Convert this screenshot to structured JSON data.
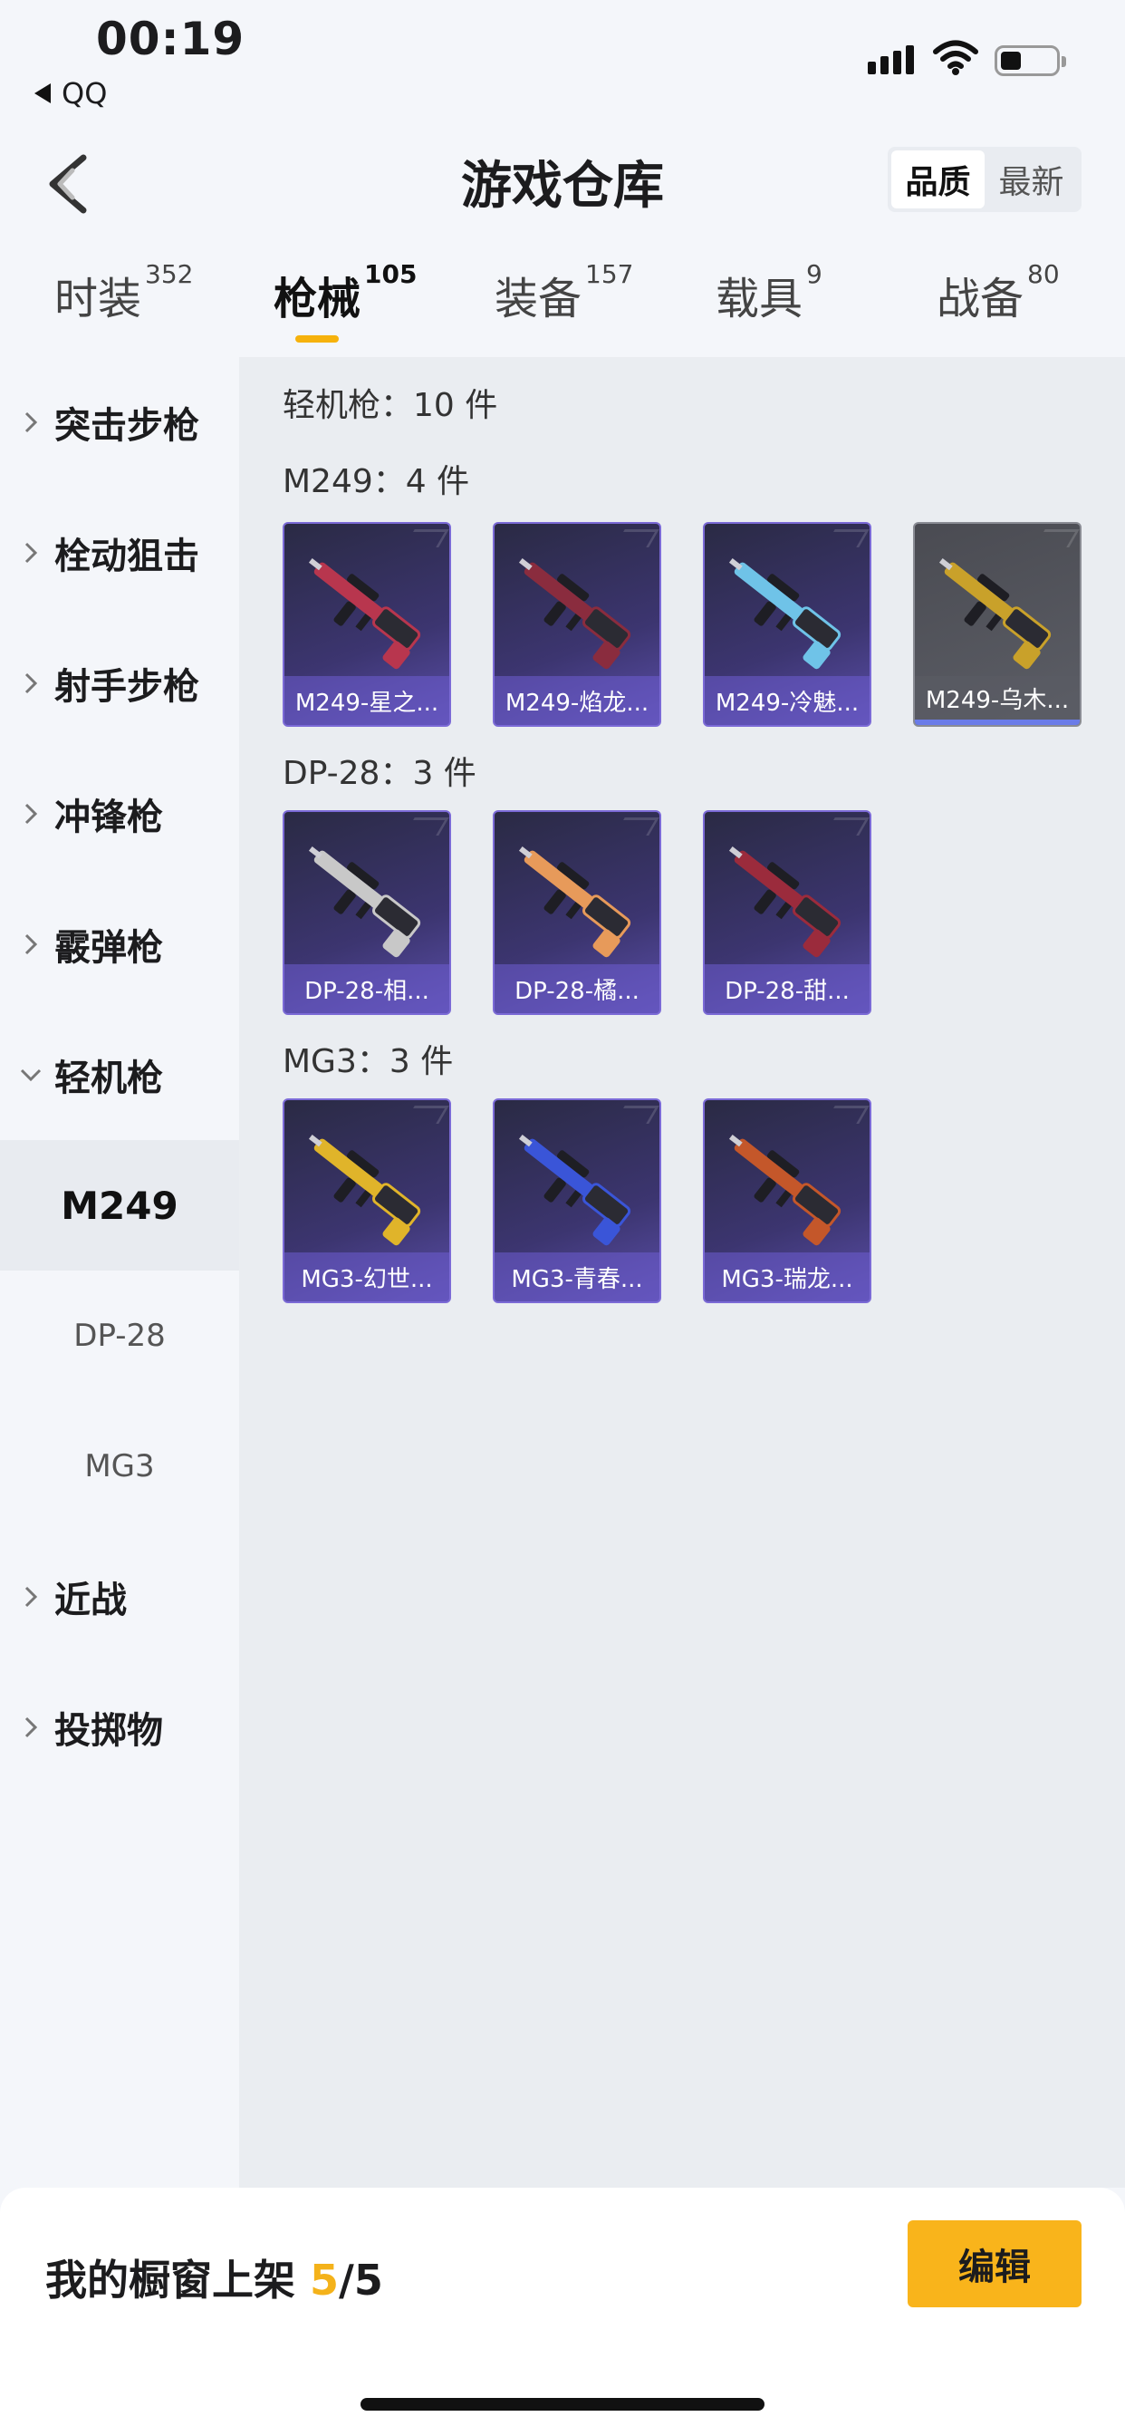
{
  "status_bar": {
    "time": "00:19",
    "back_app": "QQ"
  },
  "header": {
    "title": "游戏仓库",
    "sort": [
      "品质",
      "最新"
    ],
    "sort_active": 0
  },
  "tabs": [
    {
      "label": "时装",
      "count": "352"
    },
    {
      "label": "枪械",
      "count": "105"
    },
    {
      "label": "装备",
      "count": "157"
    },
    {
      "label": "载具",
      "count": "9"
    },
    {
      "label": "战备",
      "count": "80"
    }
  ],
  "active_tab": 1,
  "sidebar": {
    "categories": [
      {
        "label": "突击步枪"
      },
      {
        "label": "栓动狙击"
      },
      {
        "label": "射手步枪"
      },
      {
        "label": "冲锋枪"
      },
      {
        "label": "霰弹枪"
      },
      {
        "label": "轻机枪"
      },
      {
        "label": "近战"
      },
      {
        "label": "投掷物"
      }
    ],
    "subcategories": [
      "M249",
      "DP-28",
      "MG3"
    ],
    "active_sub": "M249"
  },
  "content": {
    "section_title": "轻机枪：10 件",
    "groups": [
      {
        "title": "M249：4 件",
        "items": [
          {
            "name": "M249-星之...",
            "rarity": "purple",
            "gun_color": "#b8364e"
          },
          {
            "name": "M249-焰龙...",
            "rarity": "purple",
            "gun_color": "#8a2c3e"
          },
          {
            "name": "M249-冷魅...",
            "rarity": "purple",
            "gun_color": "#6fc3e8"
          },
          {
            "name": "M249-乌木...",
            "rarity": "gray",
            "gun_color": "#c9a12a"
          }
        ]
      },
      {
        "title": "DP-28：3 件",
        "items": [
          {
            "name": "DP-28-相...",
            "rarity": "purple",
            "gun_color": "#c8c8c8"
          },
          {
            "name": "DP-28-橘...",
            "rarity": "purple",
            "gun_color": "#e79a5a"
          },
          {
            "name": "DP-28-甜...",
            "rarity": "purple",
            "gun_color": "#9b2b3c"
          }
        ]
      },
      {
        "title": "MG3：3 件",
        "items": [
          {
            "name": "MG3-幻世...",
            "rarity": "purple",
            "gun_color": "#e0b42a"
          },
          {
            "name": "MG3-青春...",
            "rarity": "purple",
            "gun_color": "#3a55d8"
          },
          {
            "name": "MG3-瑞龙...",
            "rarity": "purple",
            "gun_color": "#c4572a"
          }
        ]
      }
    ]
  },
  "footer": {
    "showcase_label": "我的橱窗上架",
    "showcase_current": "5",
    "showcase_total": "/5",
    "edit_label": "编辑"
  }
}
